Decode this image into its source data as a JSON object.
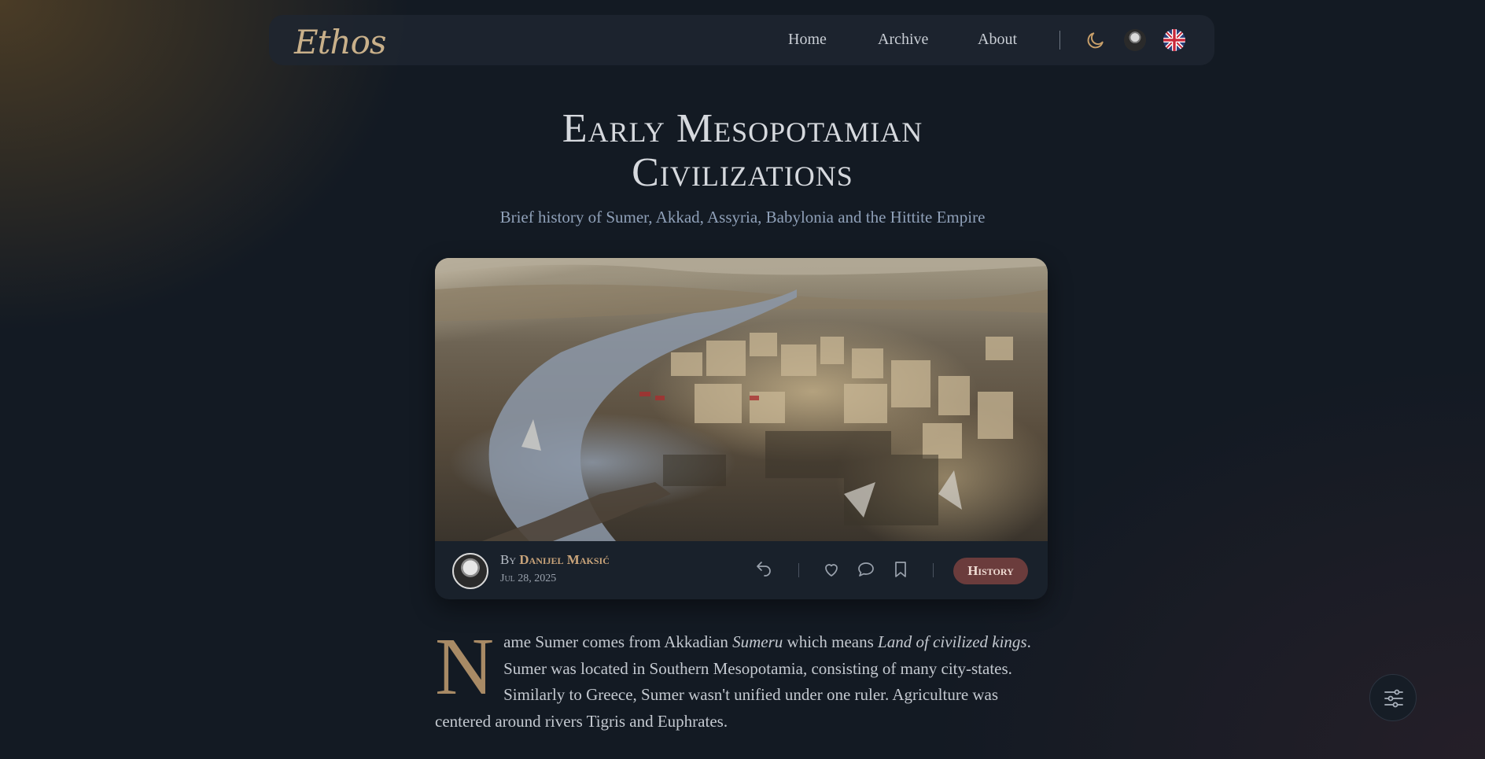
{
  "nav": {
    "logo": "Ethos",
    "links": [
      {
        "label": "Home"
      },
      {
        "label": "Archive"
      },
      {
        "label": "About"
      }
    ],
    "icons": [
      "moon-icon",
      "user-avatar",
      "uk-flag-icon"
    ]
  },
  "article": {
    "title_line1": "Early Mesopotamian",
    "title_line2": "Civilizations",
    "subtitle": "Brief history of Sumer, Akkad, Assyria, Babylonia and the Hittite Empire",
    "by_prefix": "By",
    "author": "Danijel Maksić",
    "date": "Jul 28, 2025",
    "tag": "History",
    "dropcap": "N",
    "body_part1": "ame Sumer comes from Akkadian ",
    "body_em1": "Sumeru",
    "body_part2": " which means ",
    "body_em2": "Land of civilized kings",
    "body_part3": ". Sumer was located in Southern Mesopotamia, consisting of many city-states. Similarly to Greece, Sumer wasn't unified under one ruler. Agriculture was centered around rivers Tigris and Euphrates."
  },
  "actions": [
    "share-icon",
    "heart-icon",
    "comment-icon",
    "bookmark-icon"
  ],
  "colors": {
    "background": "#131a23",
    "accent_gold": "#c9a47a",
    "tag_bg": "#6b3c3c"
  }
}
